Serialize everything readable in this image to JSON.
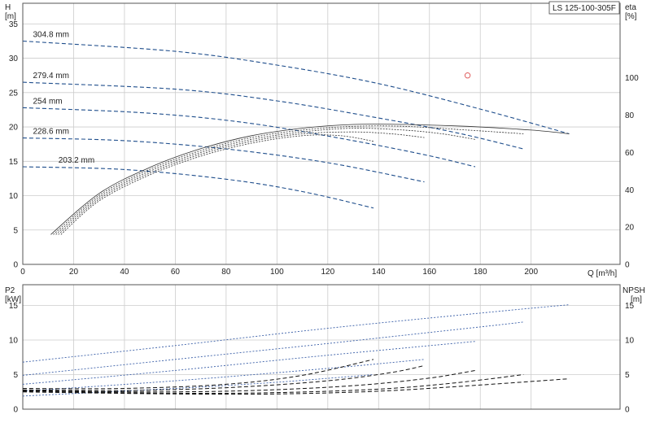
{
  "model": "LS 125-100-305F",
  "top": {
    "ylabel_left_1": "H",
    "ylabel_left_2": "[m]",
    "ylabel_right_1": "eta",
    "ylabel_right_2": "[%]",
    "xlabel": "Q [m³/h]"
  },
  "bottom": {
    "ylabel_left_1": "P2",
    "ylabel_left_2": "[kW]",
    "ylabel_right_1": "NPSH",
    "ylabel_right_2": "[m]"
  },
  "colors": {
    "head": "#1f4e8c",
    "eff": "#333333",
    "power": "#3a5fa8",
    "npsh": "#111111",
    "grid": "#cccccc",
    "duty": "#e06060"
  },
  "chart_data": [
    {
      "type": "line",
      "title": "",
      "xlabel": "Q [m³/h]",
      "ylabel": "H [m]",
      "xlim": [
        0,
        235
      ],
      "ylim": [
        0,
        38
      ],
      "x_ticks": [
        0,
        20,
        40,
        60,
        80,
        100,
        120,
        140,
        160,
        180,
        200
      ],
      "y_ticks": [
        0,
        5,
        10,
        15,
        20,
        25,
        30,
        35
      ],
      "grid": true,
      "series": [
        {
          "name": "304.8 mm",
          "kind": "head",
          "x": [
            0,
            60,
            100,
            140,
            180,
            215
          ],
          "y": [
            32.5,
            31.0,
            29.0,
            26.3,
            22.6,
            19.0
          ]
        },
        {
          "name": "279.4 mm",
          "kind": "head",
          "x": [
            0,
            60,
            100,
            140,
            170,
            197
          ],
          "y": [
            26.5,
            25.5,
            23.8,
            21.3,
            19.2,
            16.8
          ]
        },
        {
          "name": "254 mm",
          "kind": "head",
          "x": [
            0,
            50,
            90,
            130,
            160,
            178
          ],
          "y": [
            22.8,
            22.0,
            20.5,
            18.0,
            15.8,
            14.2
          ]
        },
        {
          "name": "228.6 mm",
          "kind": "head",
          "x": [
            0,
            40,
            80,
            120,
            158
          ],
          "y": [
            18.4,
            18.0,
            16.8,
            14.8,
            12.0
          ]
        },
        {
          "name": "203.2 mm",
          "kind": "head",
          "x": [
            0,
            40,
            80,
            110,
            138
          ],
          "y": [
            14.2,
            13.8,
            12.4,
            10.6,
            8.2
          ]
        }
      ],
      "right_axis": {
        "label": "eta [%]",
        "lim": [
          0,
          140
        ],
        "ticks": [
          0,
          20,
          40,
          60,
          80,
          100
        ],
        "series": [
          {
            "kind": "eff",
            "x": [
              11,
              30,
              50,
              70,
              90,
              110,
              130,
              150,
              175,
              200,
              215
            ],
            "y": [
              16,
              38,
              52,
              62,
              69,
              73,
              75,
              75,
              74,
              72,
              70
            ]
          },
          {
            "kind": "eff",
            "x": [
              12,
              30,
              50,
              70,
              90,
              110,
              130,
              150,
              175,
              197
            ],
            "y": [
              16,
              37,
              51,
              61,
              68,
              72,
              74,
              74,
              72,
              70
            ]
          },
          {
            "kind": "eff",
            "x": [
              13,
              30,
              50,
              70,
              90,
              110,
              130,
              150,
              165,
              178
            ],
            "y": [
              16,
              36,
              50,
              60,
              67,
              71,
              73,
              72,
              70,
              67
            ]
          },
          {
            "kind": "eff",
            "x": [
              14,
              30,
              50,
              70,
              90,
              110,
              130,
              145,
              158
            ],
            "y": [
              16,
              35,
              49,
              59,
              66,
              70,
              71,
              70,
              68
            ]
          },
          {
            "kind": "eff",
            "x": [
              15,
              30,
              50,
              70,
              90,
              110,
              125,
              138
            ],
            "y": [
              16,
              34,
              48,
              58,
              65,
              69,
              69,
              66
            ]
          }
        ]
      },
      "duty_point": {
        "x": 175,
        "y": 27.5
      }
    },
    {
      "type": "line",
      "title": "",
      "xlabel": "Q [m³/h]",
      "ylabel": "P2 [kW]",
      "xlim": [
        0,
        235
      ],
      "ylim": [
        0,
        18
      ],
      "y_ticks": [
        0,
        5,
        10,
        15
      ],
      "grid": true,
      "series": [
        {
          "name": "304.8 mm",
          "kind": "power",
          "x": [
            0,
            60,
            120,
            180,
            215
          ],
          "y": [
            6.8,
            9.2,
            11.7,
            13.9,
            15.1
          ]
        },
        {
          "name": "279.4 mm",
          "kind": "power",
          "x": [
            0,
            60,
            120,
            180,
            197
          ],
          "y": [
            4.9,
            7.2,
            9.5,
            11.9,
            12.6
          ]
        },
        {
          "name": "254 mm",
          "kind": "power",
          "x": [
            0,
            60,
            120,
            178
          ],
          "y": [
            3.6,
            5.6,
            7.8,
            9.8
          ]
        },
        {
          "name": "228.6 mm",
          "kind": "power",
          "x": [
            0,
            60,
            120,
            158
          ],
          "y": [
            2.6,
            4.1,
            5.9,
            7.2
          ]
        },
        {
          "name": "203.2 mm",
          "kind": "power",
          "x": [
            0,
            60,
            100,
            138
          ],
          "y": [
            1.9,
            3.0,
            3.9,
            5.0
          ]
        }
      ],
      "right_axis": {
        "label": "NPSH [m]",
        "lim": [
          0,
          18
        ],
        "ticks": [
          0,
          5,
          10,
          15
        ],
        "series": [
          {
            "kind": "npsh",
            "x": [
              0,
              60,
              100,
              140,
              180,
              215
            ],
            "y": [
              2.5,
              2.2,
              2.2,
              2.6,
              3.5,
              4.4
            ]
          },
          {
            "kind": "npsh",
            "x": [
              0,
              60,
              100,
              140,
              170,
              197
            ],
            "y": [
              2.6,
              2.3,
              2.4,
              2.9,
              3.8,
              5.0
            ]
          },
          {
            "kind": "npsh",
            "x": [
              0,
              50,
              90,
              130,
              160,
              178
            ],
            "y": [
              2.7,
              2.5,
              2.7,
              3.4,
              4.5,
              5.6
            ]
          },
          {
            "kind": "npsh",
            "x": [
              0,
              40,
              80,
              120,
              145,
              158
            ],
            "y": [
              2.8,
              2.7,
              3.1,
              4.1,
              5.3,
              6.3
            ]
          },
          {
            "kind": "npsh",
            "x": [
              0,
              40,
              80,
              110,
              138
            ],
            "y": [
              3.0,
              3.0,
              3.6,
              4.9,
              7.2
            ]
          }
        ]
      }
    }
  ]
}
